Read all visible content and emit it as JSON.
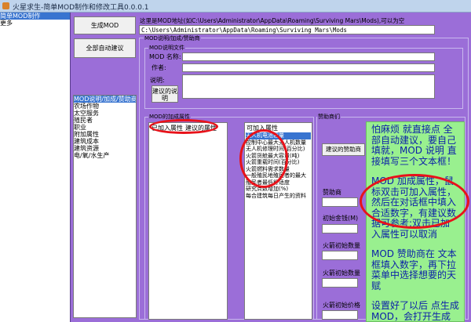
{
  "window": {
    "title": "火星求生-简单MOD制作和修改工具0.0.0.1"
  },
  "left_list": {
    "items": [
      {
        "label": "简单MOD制作",
        "selected": true
      },
      {
        "label": "更多",
        "selected": false
      }
    ]
  },
  "buttons": {
    "generate": "生成MOD",
    "auto_suggest_all": "全部自动建议",
    "suggest_description": "建议的说明",
    "suggest_sponsor": "建议的赞助商"
  },
  "path": {
    "hint": "这里是MOD地址(如C:\\Users\\Administrator\\AppData\\Roaming\\Surviving Mars\\Mods),可以为空",
    "value": "C:\\Users\\Administrator\\AppData\\Roaming\\Surviving Mars\\Mods"
  },
  "groups": {
    "main": "MOD说明/加成/赞助商",
    "description": "MOD说明文件",
    "bonus": "MOD的加成属性",
    "sponsor": "赞助商们"
  },
  "description_form": {
    "name_label": "MOD 名称:",
    "author_label": "作者:",
    "desc_label": "说明:"
  },
  "category_list": {
    "items": [
      {
        "label": "MOD说明/加成/赞助商",
        "selected": true
      },
      {
        "label": "农场作物",
        "selected": false
      },
      {
        "label": "太空服务",
        "selected": false
      },
      {
        "label": "殖民者",
        "selected": false
      },
      {
        "label": "职业",
        "selected": false
      },
      {
        "label": "附加属性",
        "selected": false
      },
      {
        "label": "建筑成本",
        "selected": false
      },
      {
        "label": "建筑资源",
        "selected": false
      },
      {
        "label": "电/氧/水生产",
        "selected": false
      }
    ]
  },
  "bonus": {
    "added_label": "已加入属性",
    "suggested_label": "建议的属性",
    "addable_label": "可加入属性",
    "addable_items": [
      {
        "label": "无人机电池容量",
        "selected": true
      },
      {
        "label": "控制中心最大无人机数量",
        "selected": false
      },
      {
        "label": "无人机修理时间(百分比)",
        "selected": false
      },
      {
        "label": "火箭货舱最大容量(吨)",
        "selected": false
      },
      {
        "label": "火箭重载时间(百分比)",
        "selected": false
      },
      {
        "label": "火箭燃料需求数量",
        "selected": false
      },
      {
        "label": "一般殖民地殖民者的最大",
        "selected": false
      },
      {
        "label": "殖民者最低舒适度",
        "selected": false
      },
      {
        "label": "研究点数增加(%)",
        "selected": false
      },
      {
        "label": "每合建筑每日产生的资料",
        "selected": false
      }
    ]
  },
  "sponsor": {
    "sponsor_label": "赞助商",
    "funding_label": "初始金钱(M)",
    "rockets_label": "火箭初始数量",
    "rockets2_label": "火箭初始数量",
    "rocket_price_label": "火箭初始价格"
  },
  "help_texts": {
    "p1": "怕麻烦 就直接点 全部自动建议，要自己填就，MOD 说明 直接填写三个文本框！",
    "p2": "MOD 加成属性，鼠标双击可加入属性，然后在对话框中填入合适数字，有建议数据可参考;双击已加入属性可以取消",
    "p3": "MOD 赞助商在 文本框填入数字，再下拉菜单中选择想要的天赋",
    "p4": "设置好了以后 点生成MOD，会打开生成的MOD文件夹"
  },
  "colors": {
    "window_bg": "#9b6ed8",
    "help_bg": "#99f08f",
    "help_text": "#0b1fa8",
    "annotation_red": "#e8121a",
    "selection_blue": "#3874d0"
  }
}
